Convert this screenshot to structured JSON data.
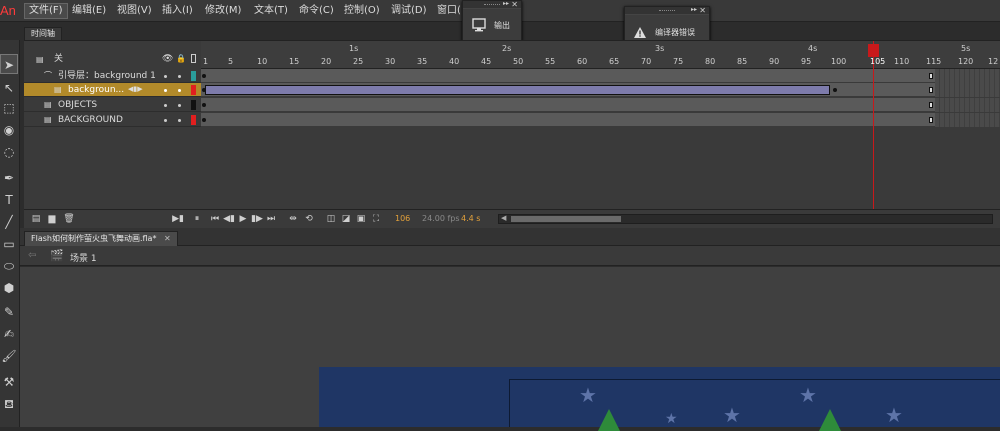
{
  "app": {
    "logo": "An"
  },
  "menu": [
    {
      "label": "文件(F)",
      "active": true
    },
    {
      "label": "编辑(E)"
    },
    {
      "label": "视图(V)"
    },
    {
      "label": "插入(I)"
    },
    {
      "label": "修改(M)"
    },
    {
      "label": "文本(T)"
    },
    {
      "label": "命令(C)"
    },
    {
      "label": "控制(O)"
    },
    {
      "label": "调试(D)"
    },
    {
      "label": "窗口("
    }
  ],
  "panels": {
    "output": {
      "label": "输出"
    },
    "compiler": {
      "label": "编译器错误"
    }
  },
  "timeline": {
    "tab": "时间轴",
    "header": {
      "label": "关"
    },
    "seconds": [
      "1s",
      "2s",
      "3s",
      "4s",
      "5s"
    ],
    "frame_numbers": [
      "1",
      "5",
      "10",
      "15",
      "20",
      "25",
      "30",
      "35",
      "40",
      "45",
      "50",
      "55",
      "60",
      "65",
      "70",
      "75",
      "80",
      "85",
      "90",
      "95",
      "100",
      "105",
      "110",
      "115",
      "120",
      "12"
    ],
    "playhead_frame": "105",
    "layers": [
      {
        "name": "引导层：background 1",
        "type": "guide",
        "color": "#2a9d9b"
      },
      {
        "name": "backgroun...",
        "type": "normal",
        "color": "#e11f1f",
        "selected": true
      },
      {
        "name": "OBJECTS",
        "type": "normal",
        "color": "#111111"
      },
      {
        "name": "BACKGROUND",
        "type": "normal",
        "color": "#e11f1f"
      }
    ],
    "footer": {
      "current_frame": "106",
      "fps": "24.00 fps",
      "time": "4.4 s"
    }
  },
  "document": {
    "tab": "Flash如何制作萤火虫飞舞动画.fla*",
    "scene": "场景 1"
  },
  "colors": {
    "stage": "#1f3665",
    "tween": "#7d7bab",
    "playhead": "#c8191b",
    "selected_layer": "#b28a2a"
  }
}
